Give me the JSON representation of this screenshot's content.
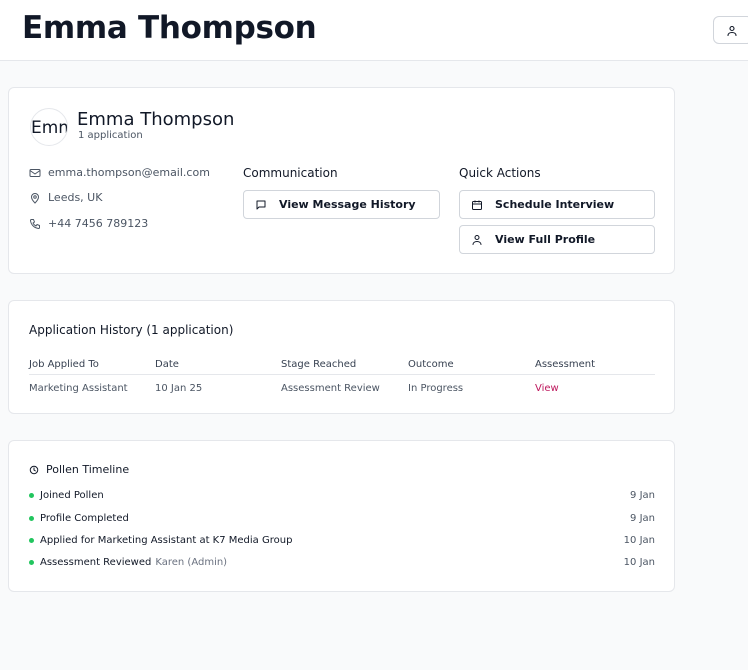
{
  "header": {
    "title": "Emma Thompson",
    "user_icon": "user-icon"
  },
  "profile": {
    "avatar_alt": "Emma Thompson",
    "name": "Emma Thompson",
    "subtitle": "1 application",
    "email": "emma.thompson@email.com",
    "location": "Leeds, UK",
    "phone": "+44 7456 789123",
    "communication_heading": "Communication",
    "message_history_label": "View Message History",
    "quick_actions_heading": "Quick Actions",
    "schedule_label": "Schedule Interview",
    "full_profile_label": "View Full Profile"
  },
  "history": {
    "title": "Application History (1 application)",
    "columns": [
      "Job Applied To",
      "Date",
      "Stage Reached",
      "Outcome",
      "Assessment"
    ],
    "rows": [
      {
        "job": "Marketing Assistant",
        "date": "10 Jan 25",
        "stage": "Assessment Review",
        "outcome": "In Progress",
        "assessment": "View"
      }
    ]
  },
  "timeline": {
    "title": "Pollen Timeline",
    "items": [
      {
        "label": "Joined Pollen",
        "meta": "",
        "date": "9 Jan"
      },
      {
        "label": "Profile Completed",
        "meta": "",
        "date": "9 Jan"
      },
      {
        "label": "Applied for Marketing Assistant at K7 Media Group",
        "meta": "",
        "date": "10 Jan"
      },
      {
        "label": "Assessment Reviewed",
        "meta": "Karen (Admin)",
        "date": "10 Jan"
      }
    ]
  },
  "colors": {
    "accent_link": "#be185d",
    "status_dot": "#22c55e",
    "text_primary": "#111827",
    "border": "#e5e7eb"
  }
}
